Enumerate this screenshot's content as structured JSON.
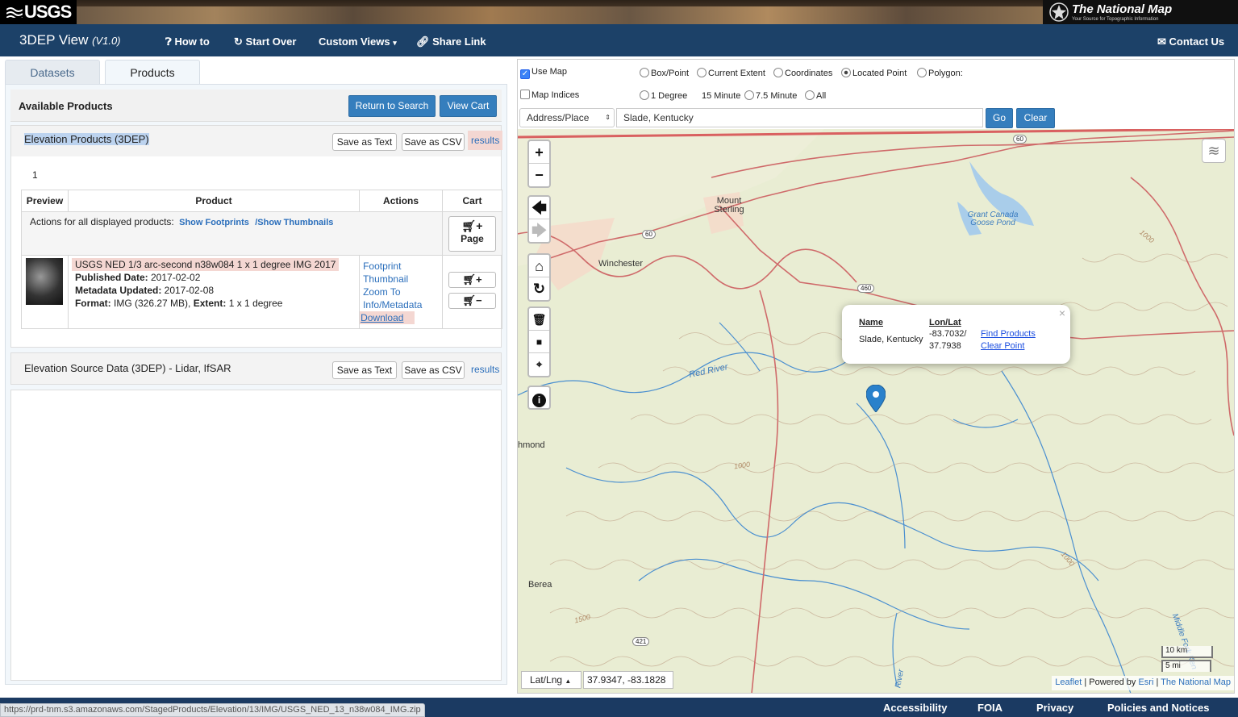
{
  "brand": {
    "usgs": "USGS",
    "tnm_title": "The National Map",
    "tnm_subtitle": "Your Source for Topographic Information"
  },
  "nav": {
    "app_title": "3DEP View",
    "version": "(V1.0)",
    "how_to": "How to",
    "start_over": "Start Over",
    "custom_views": "Custom Views",
    "share_link": "Share Link",
    "contact_us": "Contact Us"
  },
  "tabs": {
    "datasets": "Datasets",
    "products": "Products"
  },
  "available": {
    "heading": "Available Products",
    "return_btn": "Return to Search",
    "view_cart_btn": "View Cart"
  },
  "elevation": {
    "title": "Elevation Products (3DEP)",
    "save_text": "Save as Text",
    "save_csv": "Save as CSV",
    "results": "results",
    "page_number": "1",
    "columns": [
      "Preview",
      "Product",
      "Actions",
      "Cart"
    ],
    "actions_label": "Actions for all displayed products:",
    "show_footprints": "Show Footprints",
    "show_thumbnails": "/Show Thumbnails",
    "cart_page_label": "Page",
    "product": {
      "title": "USGS NED 1/3 arc-second n38w084 1 x 1 degree IMG 2017",
      "published_label": "Published Date:",
      "published": "2017-02-02",
      "metadata_label": "Metadata Updated:",
      "metadata": "2017-02-08",
      "format_label": "Format:",
      "format": "IMG (326.27 MB),",
      "extent_label": "Extent:",
      "extent": "1 x 1 degree",
      "actions": [
        "Footprint",
        "Thumbnail",
        "Zoom To",
        "Info/Metadata",
        "Download"
      ]
    }
  },
  "source": {
    "title": "Elevation Source Data (3DEP) - Lidar, IfSAR",
    "save_text": "Save as Text",
    "save_csv": "Save as CSV",
    "results": "results"
  },
  "map_options": {
    "use_map": "Use Map",
    "map_indices": "Map Indices",
    "mode_options": [
      "Box/Point",
      "Current Extent",
      "Coordinates",
      "Located Point",
      "Polygon:"
    ],
    "selected_mode": "Located Point",
    "grid_options": [
      "1 Degree",
      "15 Minute",
      "7.5 Minute",
      "All"
    ],
    "search_type": "Address/Place",
    "search_value": "Slade, Kentucky",
    "go": "Go",
    "clear": "Clear"
  },
  "map": {
    "labels": {
      "mount_sterling": "Mount Sterling",
      "winchester": "Winchester",
      "richmond": "hmond",
      "berea": "Berea",
      "red_river": "Red River",
      "lake": "Grant Canada Goose Pond",
      "middle_fork": "Middle Fork Ken",
      "river": "River"
    },
    "route_shields": [
      "60",
      "60",
      "460",
      "421"
    ],
    "contours": [
      "1000",
      "1000",
      "1000",
      "1500"
    ],
    "popup": {
      "name_header": "Name",
      "lonlat_header": "Lon/Lat",
      "name": "Slade, Kentucky",
      "lon": "-83.7032/",
      "lat": "37.7938",
      "find_products": "Find Products",
      "clear_point": "Clear Point"
    },
    "scale": {
      "km": "10 km",
      "mi": "5 mi"
    },
    "coord_mode": "Lat/Lng",
    "coord_value": "37.9347, -83.1828",
    "attribution": {
      "leaflet": "Leaflet",
      "powered": "| Powered by",
      "esri": "Esri",
      "sep": "|",
      "tnm": "The National Map"
    }
  },
  "status_url": "https://prd-tnm.s3.amazonaws.com/StagedProducts/Elevation/13/IMG/USGS_NED_13_n38w084_IMG.zip",
  "footer": {
    "accessibility": "Accessibility",
    "foia": "FOIA",
    "privacy": "Privacy",
    "policies": "Policies and Notices"
  },
  "colors": {
    "nav_bg": "#1c4168",
    "button_blue": "#357ebd",
    "link_blue": "#2a6ebb",
    "highlight": "#f4d7d2",
    "footer_bg": "#1b3a62"
  }
}
